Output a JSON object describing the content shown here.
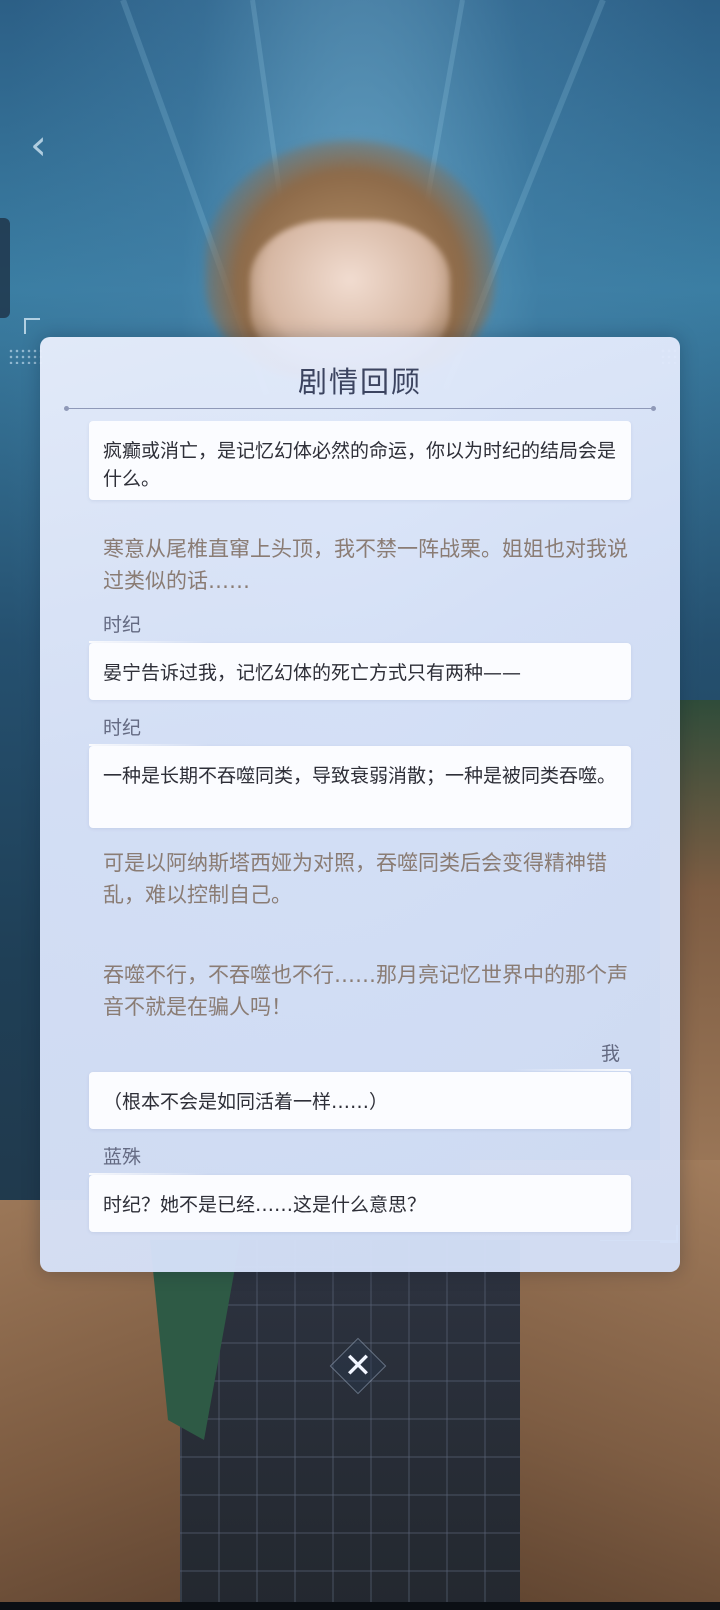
{
  "panel": {
    "title": "剧情回顾"
  },
  "log": [
    {
      "kind": "bubble",
      "speaker": "",
      "text": "疯癫或消亡，是记忆幻体必然的命运，你以为时纪的结局会是什么。"
    },
    {
      "kind": "narration",
      "text": "寒意从尾椎直窜上头顶，我不禁一阵战栗。姐姐也对我说过类似的话……"
    },
    {
      "kind": "bubble",
      "speaker": "时纪",
      "side": "left",
      "text": "晏宁告诉过我，记忆幻体的死亡方式只有两种——"
    },
    {
      "kind": "bubble",
      "speaker": "时纪",
      "side": "left",
      "text": "一种是长期不吞噬同类，导致衰弱消散；一种是被同类吞噬。"
    },
    {
      "kind": "narration",
      "text": "可是以阿纳斯塔西娅为对照，吞噬同类后会变得精神错乱，难以控制自己。"
    },
    {
      "kind": "narration",
      "text": "吞噬不行，不吞噬也不行……那月亮记忆世界中的那个声音不就是在骗人吗！"
    },
    {
      "kind": "bubble",
      "speaker": "我",
      "side": "right",
      "text": "（根本不会是如同活着一样……）"
    },
    {
      "kind": "bubble",
      "speaker": "蓝殊",
      "side": "left",
      "text": "时纪？她不是已经……这是什么意思？"
    }
  ],
  "close_button": {
    "icon": "close-icon",
    "glyph": "✕"
  },
  "nav": {
    "back_icon": "chevron-left-icon",
    "glyph": "‹"
  },
  "colors": {
    "panel_bg": "#dfe7fa",
    "bubble_bg": "#fbfcff",
    "narration_text": "#8a7c74",
    "speaker_text": "#646a82",
    "title_text": "#3c4460"
  }
}
